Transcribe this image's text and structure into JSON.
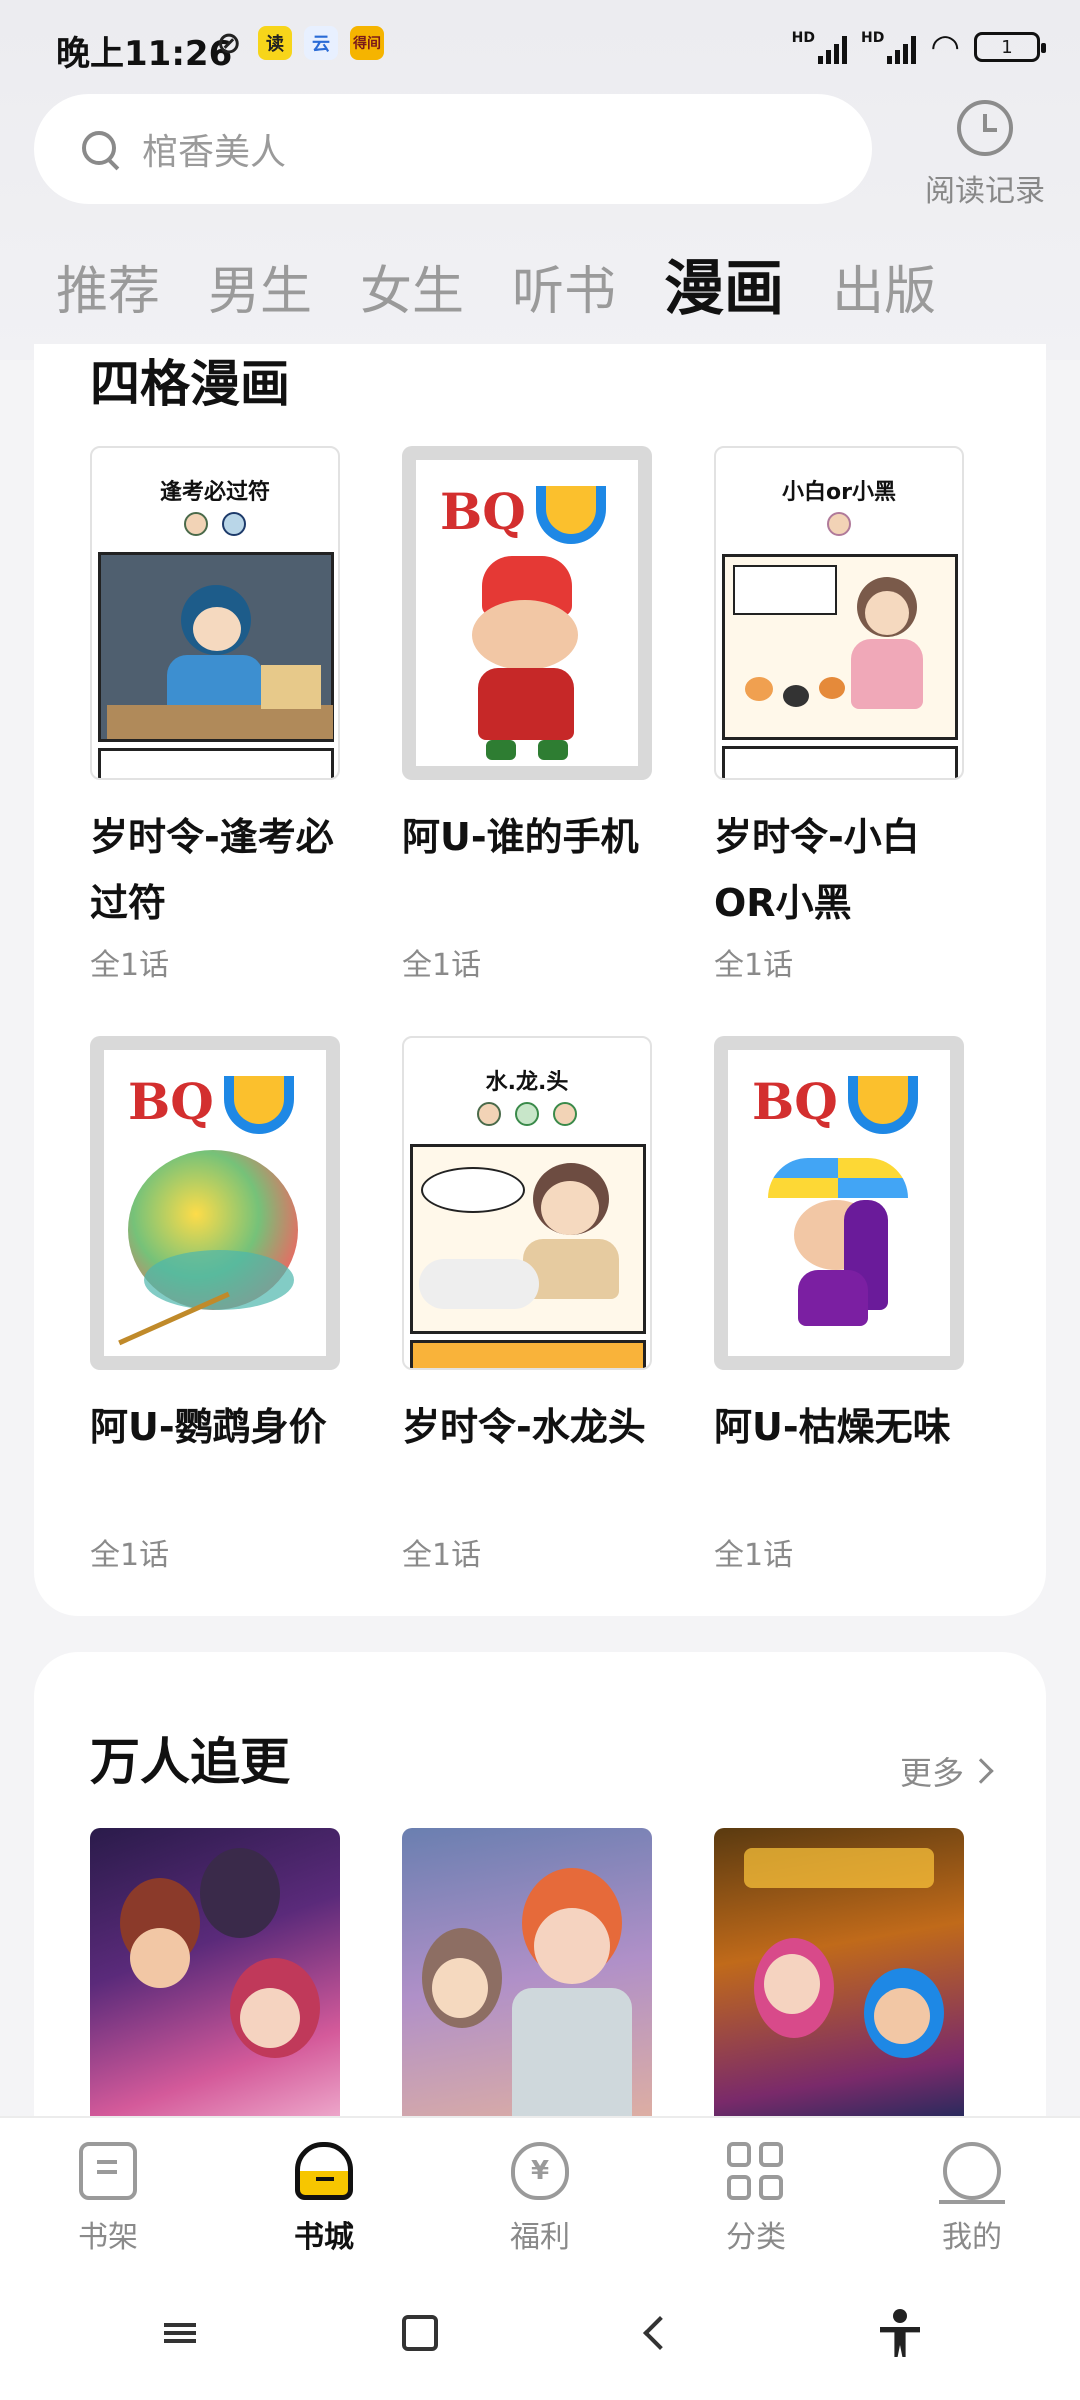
{
  "status_bar": {
    "time": "晚上11:26",
    "apps": [
      {
        "name": "mute-icon",
        "label": ""
      },
      {
        "name": "read-app-icon",
        "label": "读",
        "color": "#f7d51a"
      },
      {
        "name": "cloud-app-icon",
        "label": "云",
        "color": "#e8f0ff"
      },
      {
        "name": "dewu-app-icon",
        "label": "得间",
        "color": "#f5b400"
      }
    ],
    "signal_1": "HD",
    "signal_2": "HD",
    "battery": "1"
  },
  "search": {
    "placeholder": "棺香美人"
  },
  "history": {
    "label": "阅读记录"
  },
  "tabs": [
    {
      "label": "推荐",
      "active": false
    },
    {
      "label": "男生",
      "active": false
    },
    {
      "label": "女生",
      "active": false
    },
    {
      "label": "听书",
      "active": false
    },
    {
      "label": "漫画",
      "active": true
    },
    {
      "label": "出版",
      "active": false
    }
  ],
  "section_four_panel": {
    "title": "四格漫画",
    "books": [
      {
        "title": "岁时令-逢考必过符",
        "count": "全1话",
        "cover_caption": "逢考必过符"
      },
      {
        "title": "阿U-谁的手机",
        "count": "全1话",
        "cover_caption": ""
      },
      {
        "title": "岁时令-小白OR小黑",
        "count": "全1话",
        "cover_caption": "小白or小黑"
      },
      {
        "title": "阿U-鹦鹉身价",
        "count": "全1话",
        "cover_caption": ""
      },
      {
        "title": "岁时令-水龙头",
        "count": "全1话",
        "cover_caption": "水.龙.头"
      },
      {
        "title": "阿U-枯燥无味",
        "count": "全1话",
        "cover_caption": ""
      }
    ]
  },
  "section_popular": {
    "title": "万人追更",
    "more_label": "更多"
  },
  "bottom_nav": [
    {
      "label": "书架",
      "icon": "bookshelf-icon",
      "active": false
    },
    {
      "label": "书城",
      "icon": "bookstore-icon",
      "active": true
    },
    {
      "label": "福利",
      "icon": "welfare-icon",
      "active": false
    },
    {
      "label": "分类",
      "icon": "category-icon",
      "active": false
    },
    {
      "label": "我的",
      "icon": "profile-icon",
      "active": false
    }
  ],
  "colors": {
    "accent": "#f7c600",
    "text_primary": "#111111",
    "text_secondary": "#8a8a8a",
    "background": "#f4f4f6"
  }
}
